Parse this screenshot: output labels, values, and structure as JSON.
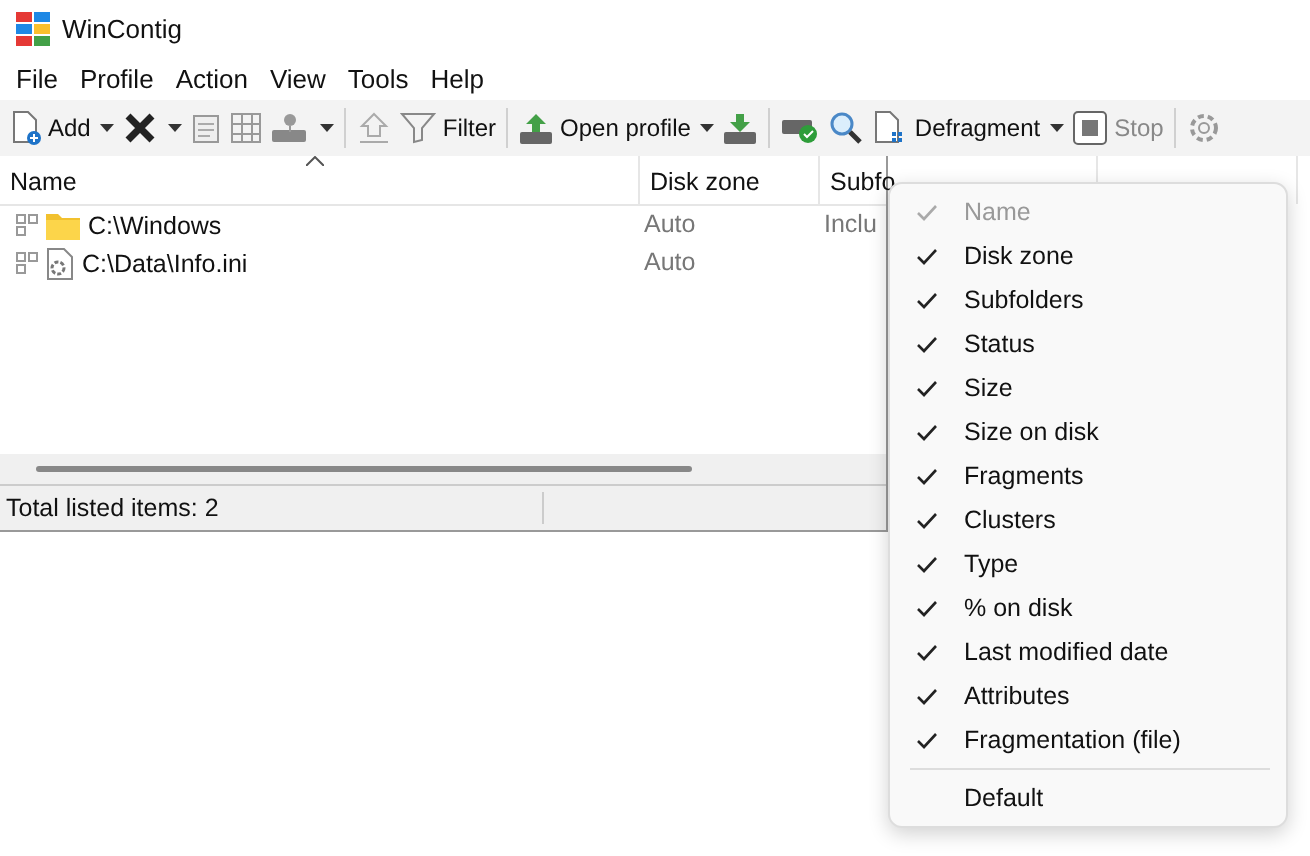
{
  "window": {
    "title": "WinContig"
  },
  "menu": [
    "File",
    "Profile",
    "Action",
    "View",
    "Tools",
    "Help"
  ],
  "toolbar": [
    {
      "kind": "add",
      "label": "Add",
      "dropdown": true
    },
    {
      "kind": "delete",
      "dropdown": true
    },
    {
      "kind": "props"
    },
    {
      "kind": "grid"
    },
    {
      "kind": "drive",
      "dropdown": true
    },
    {
      "kind": "sep"
    },
    {
      "kind": "up"
    },
    {
      "kind": "filter",
      "label": "Filter"
    },
    {
      "kind": "sep"
    },
    {
      "kind": "open",
      "label": "Open profile",
      "dropdown": true
    },
    {
      "kind": "save"
    },
    {
      "kind": "sep"
    },
    {
      "kind": "check"
    },
    {
      "kind": "search"
    },
    {
      "kind": "defrag",
      "label": "Defragment",
      "dropdown": true
    },
    {
      "kind": "stop",
      "label": "Stop",
      "disabled": true
    },
    {
      "kind": "sep"
    },
    {
      "kind": "gear"
    }
  ],
  "table": {
    "columns": [
      "Name",
      "Disk zone",
      "Subfo"
    ],
    "rows": [
      {
        "kind": "folder",
        "name": "C:\\Windows",
        "zone": "Auto",
        "sub": "Inclu"
      },
      {
        "kind": "file",
        "name": "C:\\Data\\Info.ini",
        "zone": "Auto"
      }
    ]
  },
  "status_bar": "Total listed items: 2",
  "context_menu": {
    "items": [
      {
        "label": "Name",
        "checked": true,
        "disabled": true
      },
      {
        "label": "Disk zone",
        "checked": true,
        "disabled": false
      },
      {
        "label": "Subfolders",
        "checked": true,
        "disabled": false
      },
      {
        "label": "Status",
        "checked": true,
        "disabled": false
      },
      {
        "label": "Size",
        "checked": true,
        "disabled": false
      },
      {
        "label": "Size on disk",
        "checked": true,
        "disabled": false
      },
      {
        "label": "Fragments",
        "checked": true,
        "disabled": false
      },
      {
        "label": "Clusters",
        "checked": true,
        "disabled": false
      },
      {
        "label": "Type",
        "checked": true,
        "disabled": false
      },
      {
        "label": "% on disk",
        "checked": true,
        "disabled": false
      },
      {
        "label": "Last modified date",
        "checked": true,
        "disabled": false
      },
      {
        "label": "Attributes",
        "checked": true,
        "disabled": false
      },
      {
        "label": "Fragmentation (file)",
        "checked": true,
        "disabled": false
      }
    ],
    "footer": "Default"
  }
}
